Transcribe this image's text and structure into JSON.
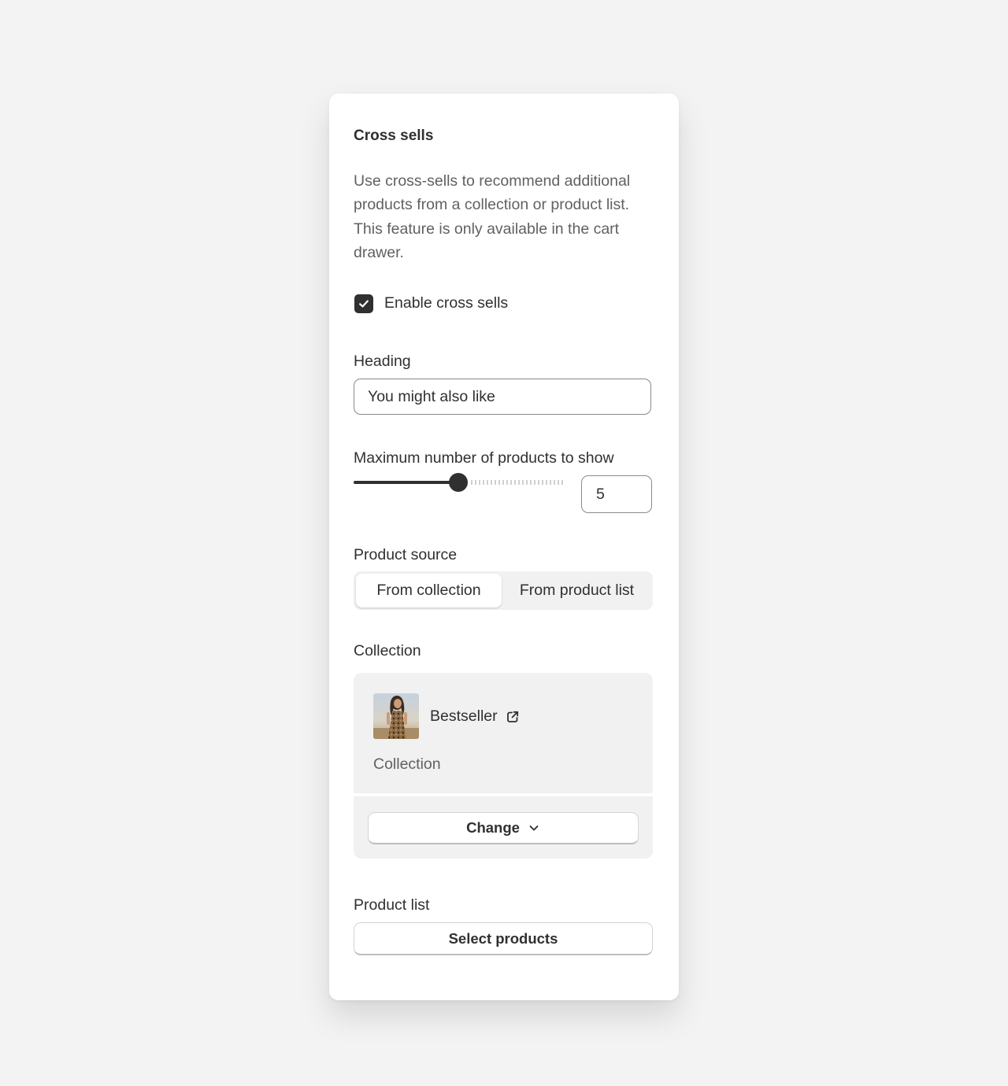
{
  "panel": {
    "title": "Cross sells",
    "description": "Use cross-sells to recommend additional products from a collection or product list. This feature is only available in the cart drawer."
  },
  "enable_checkbox": {
    "label": "Enable cross sells",
    "checked": true
  },
  "heading_field": {
    "label": "Heading",
    "value": "You might also like"
  },
  "max_products": {
    "label": "Maximum number of products to show",
    "value": "5",
    "slider_fraction": 0.5
  },
  "product_source": {
    "label": "Product source",
    "options": [
      "From collection",
      "From product list"
    ],
    "selected": "From collection"
  },
  "collection": {
    "label": "Collection",
    "name": "Bestseller",
    "type": "Collection",
    "change_label": "Change"
  },
  "product_list": {
    "label": "Product list",
    "button_label": "Select products"
  },
  "icons": {
    "checkbox": "checkmark-icon",
    "external": "external-link-icon",
    "dropdown": "chevron-down-icon"
  },
  "colors": {
    "accent": "#303030",
    "background": "#f3f3f3",
    "card": "#ffffff",
    "muted_text": "#616161"
  }
}
